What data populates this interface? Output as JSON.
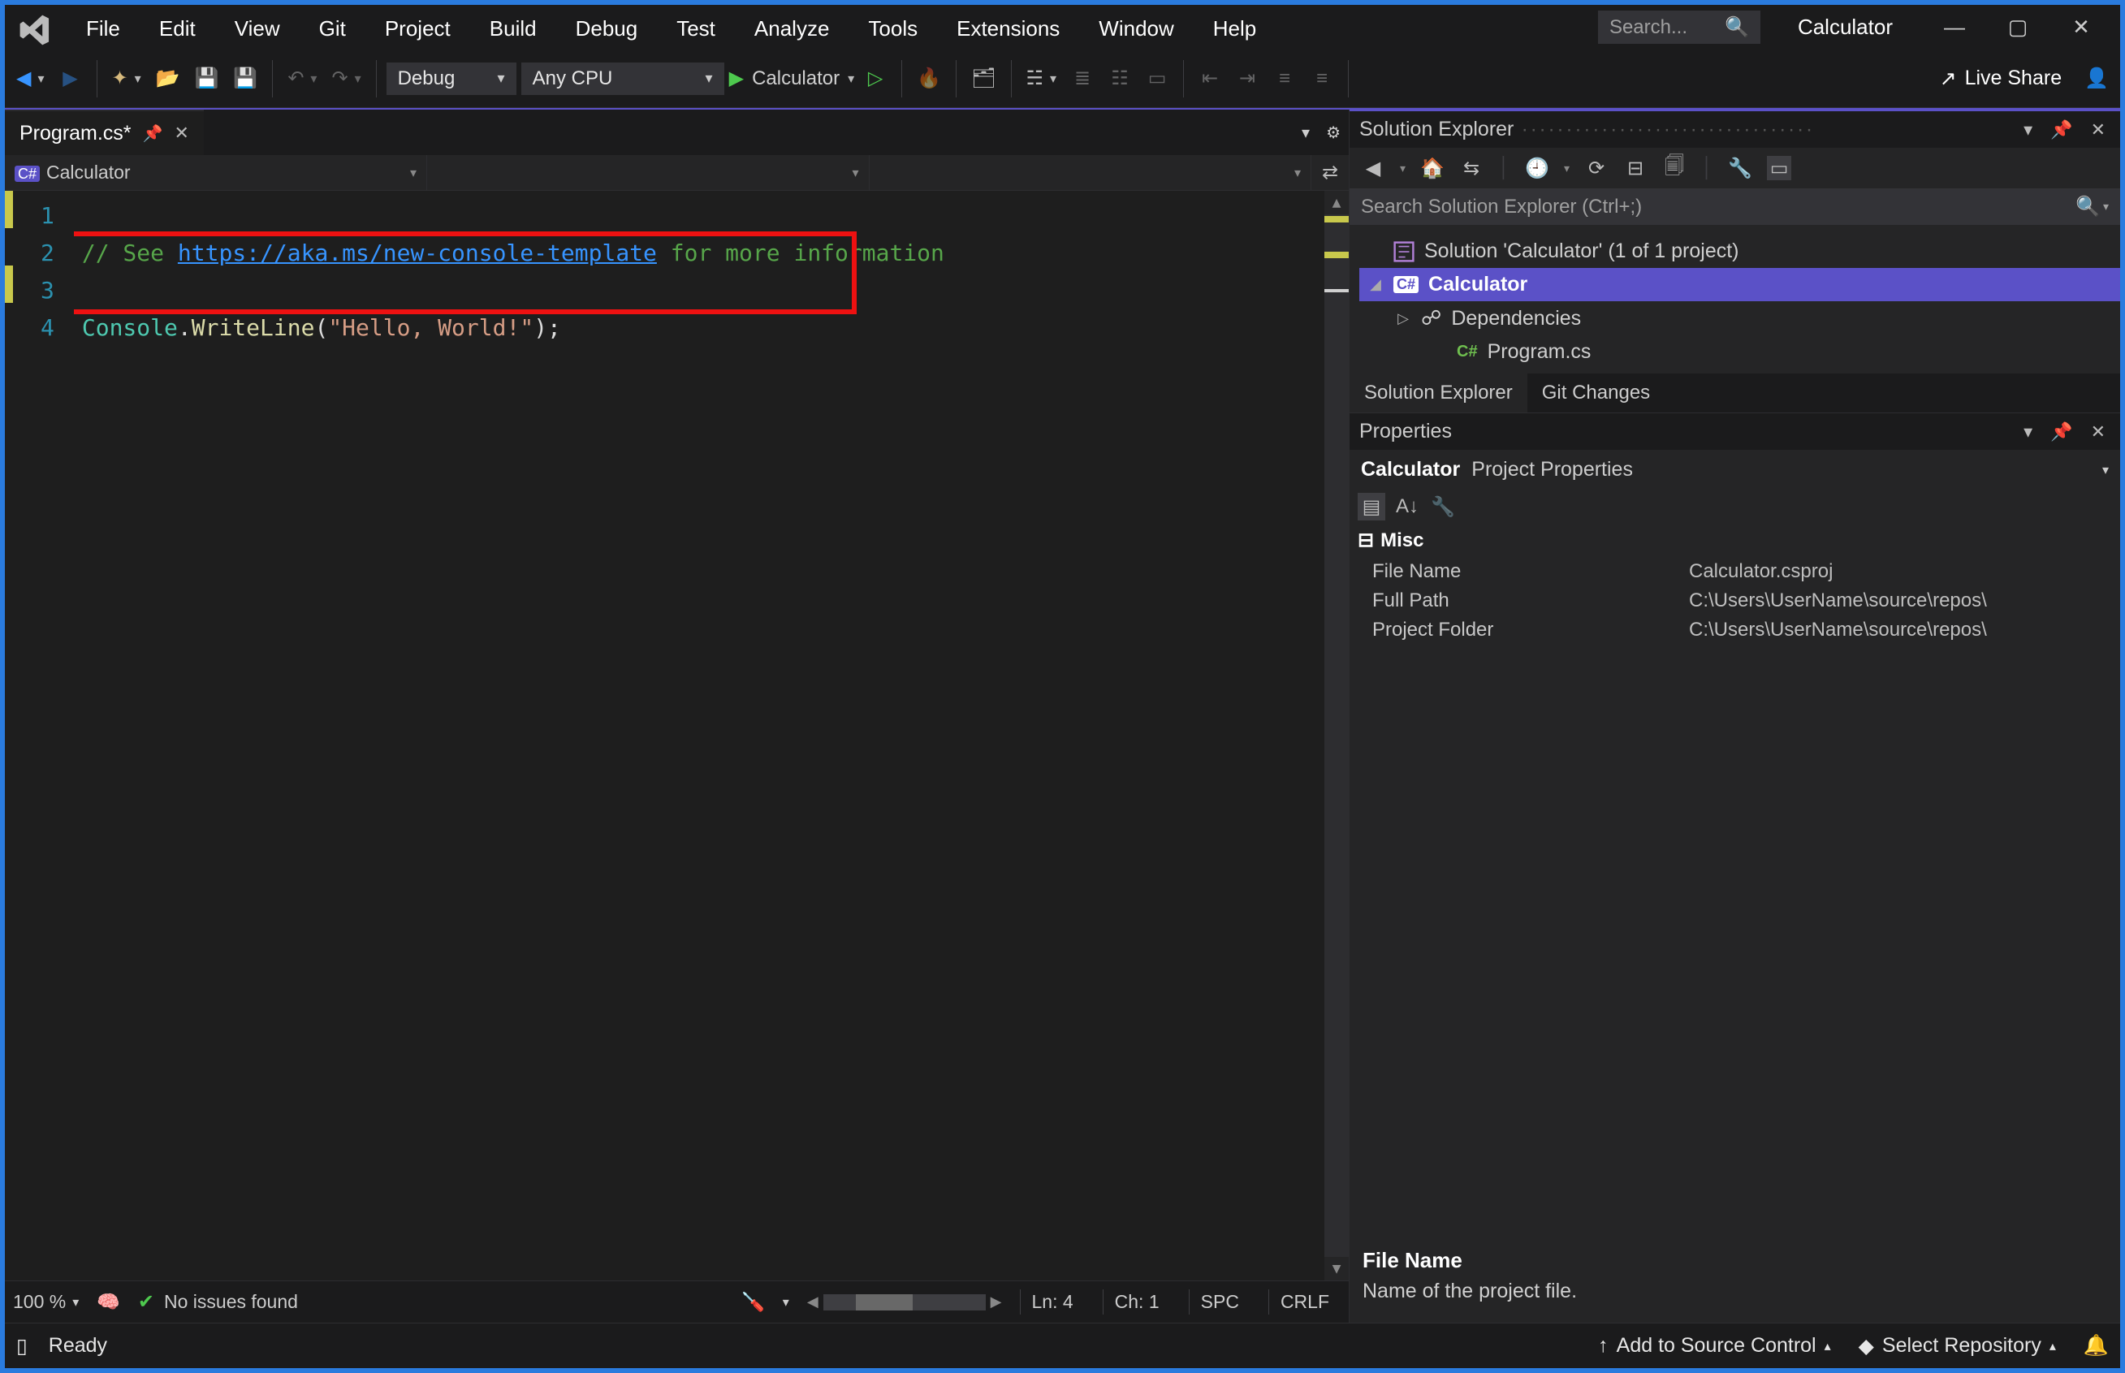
{
  "menu": [
    "File",
    "Edit",
    "View",
    "Git",
    "Project",
    "Build",
    "Debug",
    "Test",
    "Analyze",
    "Tools",
    "Extensions",
    "Window",
    "Help"
  ],
  "title_search_placeholder": "Search...",
  "title_project": "Calculator",
  "toolbar": {
    "config": "Debug",
    "platform": "Any CPU",
    "start_target": "Calculator",
    "live_share": "Live Share"
  },
  "doc_tab": {
    "label": "Program.cs*"
  },
  "nav": {
    "scope": "Calculator",
    "scope_icon": "C#"
  },
  "code": {
    "lines": [
      "1",
      "2",
      "3",
      "4"
    ],
    "comment_prefix": "// See ",
    "comment_link": "https://aka.ms/new-console-template",
    "comment_suffix": " for more information",
    "l3_type": "Console",
    "l3_dot": ".",
    "l3_method": "WriteLine",
    "l3_open": "(",
    "l3_string": "\"Hello, World!\"",
    "l3_close": ");"
  },
  "editor_status": {
    "zoom": "100 %",
    "issues": "No issues found",
    "line": "Ln: 4",
    "col": "Ch: 1",
    "ws": "SPC",
    "eol": "CRLF"
  },
  "solution_explorer": {
    "title": "Solution Explorer",
    "search_placeholder": "Search Solution Explorer (Ctrl+;)",
    "solution": "Solution 'Calculator' (1 of 1 project)",
    "project": "Calculator",
    "nodes": [
      "Dependencies",
      "Program.cs"
    ],
    "tabs": [
      "Solution Explorer",
      "Git Changes"
    ]
  },
  "properties": {
    "title": "Properties",
    "object": "Calculator",
    "object_sub": "Project Properties",
    "category": "Misc",
    "rows": [
      {
        "k": "File Name",
        "v": "Calculator.csproj"
      },
      {
        "k": "Full Path",
        "v": "C:\\Users\\UserName\\source\\repos\\"
      },
      {
        "k": "Project Folder",
        "v": "C:\\Users\\UserName\\source\\repos\\"
      }
    ],
    "desc_title": "File Name",
    "desc_body": "Name of the project file."
  },
  "statusbar": {
    "ready": "Ready",
    "add_source": "Add to Source Control",
    "select_repo": "Select Repository"
  }
}
